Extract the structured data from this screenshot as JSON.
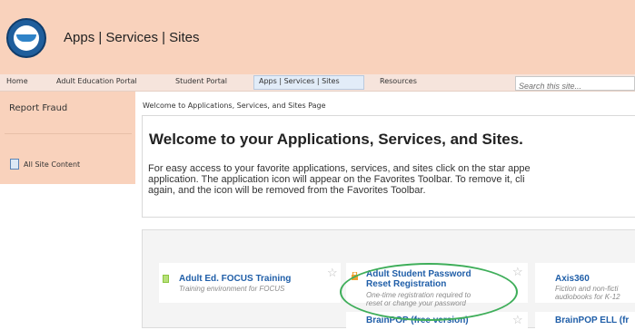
{
  "header": {
    "title": "Apps | Services | Sites"
  },
  "nav": {
    "items": [
      "Home",
      "Adult Education Portal",
      "Student Portal",
      "Apps | Services | Sites",
      "Resources"
    ],
    "search_placeholder": "Search this site..."
  },
  "sidebar": {
    "report_fraud": "Report Fraud",
    "all_site_content": "All Site Content"
  },
  "breadcrumb": "Welcome to Applications, Services, and Sites Page",
  "welcome": {
    "heading": "Welcome to your Applications, Services, and Sites.",
    "line1": "For easy access to your favorite applications, services, and sites click on the star appe",
    "line2": "application. The application icon will appear on the Favorites Toolbar.  To remove it, cli",
    "line3": "again, and the icon will be removed from the Favorites Toolbar."
  },
  "apps": [
    {
      "title": "Adult Ed. FOCUS Training",
      "desc": "Training environment for FOCUS",
      "icon": "green-book-icon"
    },
    {
      "title_line1": "Adult Student Password",
      "title_line2": "Reset Registration",
      "desc_line1": "One-time registration required to",
      "desc_line2": "reset or change your password",
      "icon": "orange-lock-icon"
    },
    {
      "title": "Axis360",
      "desc_line1": "Fiction and non-ficti",
      "desc_line2": "audiobooks for K-12",
      "icon": "book-icon"
    },
    {
      "title": "BrainPOP (free version)"
    },
    {
      "title": "BrainPOP ELL (fr"
    }
  ],
  "colors": {
    "header_bg": "#f9d2bc",
    "link": "#1f5ea8",
    "highlight_oval": "#3fae5a"
  }
}
